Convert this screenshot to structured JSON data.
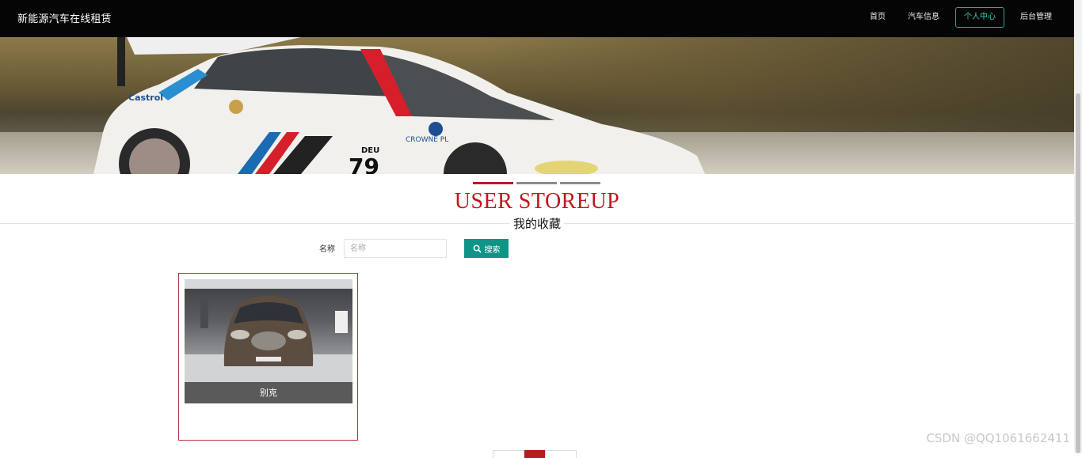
{
  "app": {
    "title": "新能源汽车在线租赁"
  },
  "nav": {
    "items": [
      {
        "label": "首页"
      },
      {
        "label": "汽车信息"
      },
      {
        "label": "个人中心",
        "active": true
      },
      {
        "label": "后台管理"
      }
    ]
  },
  "banner": {
    "slides_count": 3,
    "active_slide": 1
  },
  "section": {
    "title_en": "USER STOREUP",
    "title_cn": "我的收藏"
  },
  "search": {
    "label": "名称",
    "placeholder": "名称",
    "value": "",
    "button_label": "搜索"
  },
  "items": [
    {
      "name": "别克"
    }
  ],
  "pagination": {
    "current_page": 1
  },
  "colors": {
    "accent_red": "#c0171e",
    "teal": "#0f9488",
    "topbar": "#050505"
  },
  "watermark": "CSDN @QQ1061662411"
}
